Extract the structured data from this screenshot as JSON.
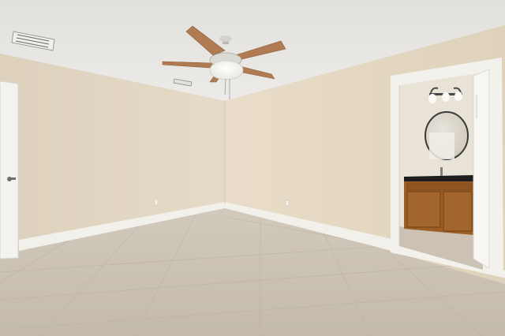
{
  "image": {
    "kind": "photo",
    "subject": "empty-bedroom-interior",
    "colors": {
      "ceiling": "#e8e6e2",
      "wall_left": "#e1d5c1",
      "wall_back": "#e8dcc8",
      "wall_right": "#e4d8c2",
      "floor": "#c9c0b2",
      "baseboard": "#f2f0ea",
      "door": "#f4f3ef",
      "fan_blade": "#b07a52",
      "cabinet": "#9a5e26",
      "countertop": "#1d1d1f"
    }
  }
}
